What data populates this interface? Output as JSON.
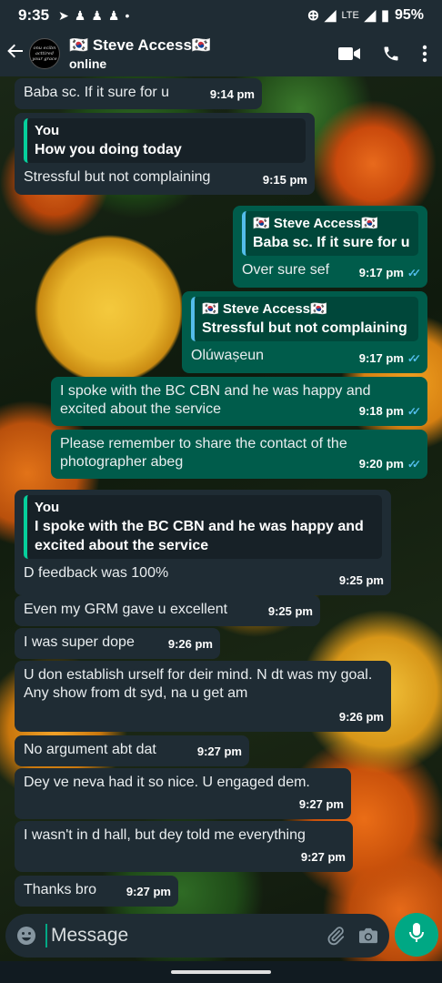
{
  "status_bar": {
    "time": "9:35",
    "battery": "95%",
    "network": "LTE"
  },
  "header": {
    "contact_name": "🇰🇷 Steve Access🇰🇷",
    "contact_status": "online",
    "avatar_text": "onu ecibn acttired your grace"
  },
  "messages": [
    {
      "dir": "in",
      "text": "Baba sc. If it sure for u",
      "time": "9:14 pm"
    },
    {
      "dir": "in",
      "quote_author": "You",
      "quote_text": "How you doing today",
      "text": "Stressful but not complaining",
      "time": "9:15 pm"
    },
    {
      "dir": "out",
      "quote_author": "🇰🇷 Steve Access🇰🇷",
      "quote_text": "Baba sc. If it sure for u",
      "text": "Over sure sef",
      "time": "9:17 pm"
    },
    {
      "dir": "out",
      "quote_author": "🇰🇷 Steve Access🇰🇷",
      "quote_text": "Stressful but not complaining",
      "text": "Olúwaṣeun",
      "time": "9:17 pm"
    },
    {
      "dir": "out",
      "text": "I spoke with the BC CBN and he was happy and excited about the service",
      "time": "9:18 pm"
    },
    {
      "dir": "out",
      "text": "Please remember to share the contact of the photographer abeg",
      "time": "9:20 pm"
    },
    {
      "dir": "in",
      "quote_author": "You",
      "quote_text": "I spoke with the BC CBN and he was happy and excited about the service",
      "text": "D feedback was 100%",
      "time": "9:25 pm"
    },
    {
      "dir": "in",
      "text": "Even my GRM gave u excellent",
      "time": "9:25 pm"
    },
    {
      "dir": "in",
      "text": "I was super dope",
      "time": "9:26 pm"
    },
    {
      "dir": "in",
      "text": "U don establish urself for deir mind. N dt was my goal. Any show from dt syd, na u get am",
      "time": "9:26 pm"
    },
    {
      "dir": "in",
      "text": "No argument abt dat",
      "time": "9:27 pm"
    },
    {
      "dir": "in",
      "text": "Dey ve neva had it so nice. U engaged dem.",
      "time": "9:27 pm"
    },
    {
      "dir": "in",
      "text": "I wasn't in d hall, but dey told me everything",
      "time": "9:27 pm"
    },
    {
      "dir": "in",
      "text": "Thanks bro",
      "time": "9:27 pm"
    }
  ],
  "composer": {
    "placeholder": "Message"
  },
  "icons": {
    "back": "back-arrow-icon",
    "video": "video-call-icon",
    "call": "phone-icon",
    "menu": "more-vert-icon",
    "emoji": "emoji-icon",
    "attach": "paperclip-icon",
    "camera": "camera-icon",
    "mic": "mic-icon"
  },
  "colors": {
    "incoming_bubble": "#1f2c34",
    "outgoing_bubble": "#005c4b",
    "accent": "#00a884",
    "read_tick": "#53bdeb"
  }
}
